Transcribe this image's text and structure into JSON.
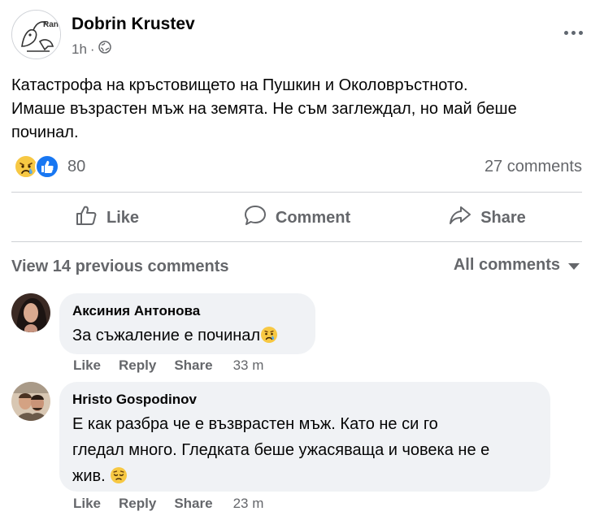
{
  "post": {
    "author": "Dobrin Krustev",
    "time": "1h",
    "privacy_icon": "globe-icon",
    "avatar_text": "Ran",
    "text_lines": [
      "Катастрофа на кръстовището на Пушкин и Околовръстното.",
      "Имаше възрастен мъж на земята. Не съм заглеждал, но май беше",
      "починал."
    ],
    "reactions": [
      "sad-reaction",
      "like-reaction"
    ],
    "reaction_count": "80",
    "comments_count": "27 comments"
  },
  "actions": {
    "like": "Like",
    "comment": "Comment",
    "share": "Share"
  },
  "comments_header": {
    "view_previous": "View 14 previous comments",
    "filter": "All comments"
  },
  "comments": [
    {
      "name": "Аксиния Антонова",
      "text": "За съжаление е починал",
      "emoji": "sad-crying-emoji",
      "like": "Like",
      "reply": "Reply",
      "share": "Share",
      "time": "33 m"
    },
    {
      "name": "Hristo Gospodinov",
      "text_lines": [
        "Е как разбра че е възврастен мъж. Като не си го",
        "гледал много. Гледката беше ужасяваща и човека не е",
        "жив."
      ],
      "emoji": "pensive-emoji",
      "like": "Like",
      "reply": "Reply",
      "share": "Share",
      "time": "23 m"
    }
  ],
  "colors": {
    "secondary_text": "#65676b",
    "bubble_bg": "#f0f2f5",
    "like_blue": "#1877f2",
    "sad_yellow": "#f7c843"
  }
}
